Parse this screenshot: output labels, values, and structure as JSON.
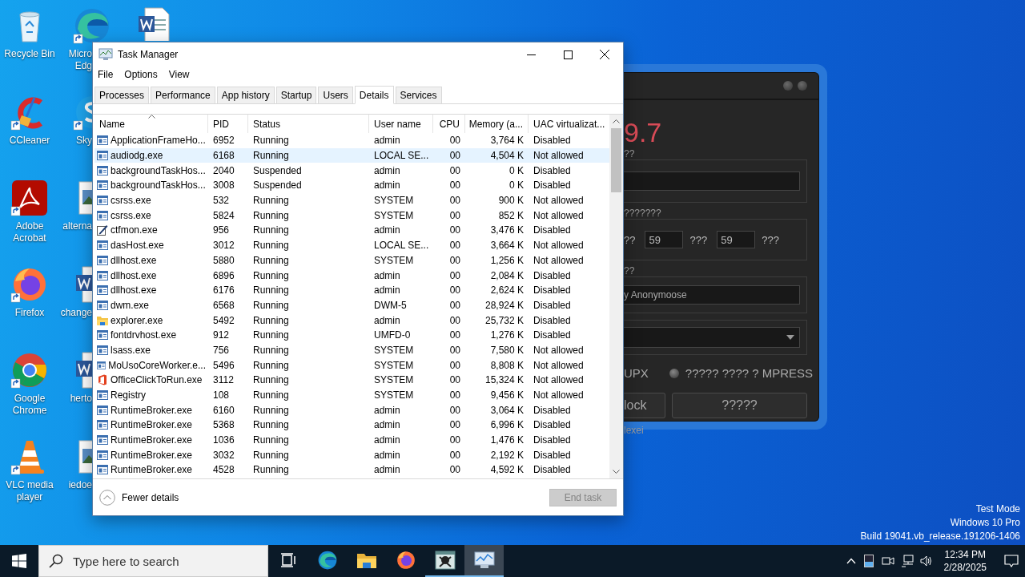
{
  "desktop": {
    "icons": [
      {
        "kind": "recycle",
        "shortcut": false,
        "lines": [
          "Recycle Bin"
        ]
      },
      {
        "kind": "ccleaner",
        "shortcut": true,
        "lines": [
          "CCleaner"
        ]
      },
      {
        "kind": "acrobat",
        "shortcut": true,
        "lines": [
          "Adobe",
          "Acrobat"
        ]
      },
      {
        "kind": "firefox",
        "shortcut": true,
        "lines": [
          "Firefox"
        ]
      },
      {
        "kind": "chrome",
        "shortcut": true,
        "lines": [
          "Google",
          "Chrome"
        ]
      },
      {
        "kind": "vlc",
        "shortcut": true,
        "lines": [
          "VLC media",
          "player"
        ]
      },
      {
        "kind": "edge",
        "shortcut": true,
        "lines": [
          "Micro",
          "Edg"
        ]
      },
      {
        "kind": "skype",
        "shortcut": true,
        "lines": [
          "Sky"
        ]
      },
      {
        "kind": "image",
        "shortcut": false,
        "lines": [
          "alterna"
        ]
      },
      {
        "kind": "word",
        "shortcut": false,
        "lines": [
          "change"
        ]
      },
      {
        "kind": "word",
        "shortcut": false,
        "lines": [
          "herto"
        ]
      },
      {
        "kind": "image",
        "shortcut": false,
        "lines": [
          "iedoe"
        ]
      },
      {
        "kind": "word",
        "shortcut": false
      }
    ],
    "notice": [
      "Test Mode",
      "Windows 10 Pro",
      "Build 19041.vb_release.191206-1406"
    ]
  },
  "background_app": {
    "version": "9.7",
    "name_label": "??",
    "time_label": "???????",
    "time_row": [
      {
        "kind": "label",
        "text": "??"
      },
      {
        "kind": "field",
        "value": "59"
      },
      {
        "kind": "label",
        "text": "???"
      },
      {
        "kind": "field",
        "value": "59"
      },
      {
        "kind": "label",
        "text": "???"
      }
    ],
    "author_label": "??",
    "author_value": "y Anonymoose",
    "upx_label": "UPX",
    "mpress_option": {
      "label": "????? ???? ? MPRESS",
      "selected": false
    },
    "buttons": [
      "lock",
      "?????"
    ],
    "footer": "lexei"
  },
  "task_manager": {
    "title": "Task Manager",
    "menu": [
      "File",
      "Options",
      "View"
    ],
    "tabs": [
      {
        "label": "Processes",
        "selected": false
      },
      {
        "label": "Performance",
        "selected": false
      },
      {
        "label": "App history",
        "selected": false
      },
      {
        "label": "Startup",
        "selected": false
      },
      {
        "label": "Users",
        "selected": false
      },
      {
        "label": "Details",
        "selected": true
      },
      {
        "label": "Services",
        "selected": false
      }
    ],
    "columns": [
      {
        "label": "Name",
        "sorted": true
      },
      {
        "label": "PID",
        "sorted": false
      },
      {
        "label": "Status",
        "sorted": false
      },
      {
        "label": "User name",
        "sorted": false
      },
      {
        "label": "CPU",
        "sorted": false
      },
      {
        "label": "Memory (a...",
        "sorted": false
      },
      {
        "label": "UAC virtualizat...",
        "sorted": false
      }
    ],
    "rows": [
      {
        "kind": "app",
        "name": "ApplicationFrameHo...",
        "pid": "6952",
        "status": "Running",
        "user": "admin",
        "cpu": "00",
        "memory": "3,764 K",
        "uac": "Disabled",
        "selected": false
      },
      {
        "kind": "app",
        "name": "audiodg.exe",
        "pid": "6168",
        "status": "Running",
        "user": "LOCAL SE...",
        "cpu": "00",
        "memory": "4,504 K",
        "uac": "Not allowed",
        "selected": true
      },
      {
        "kind": "app",
        "name": "backgroundTaskHos...",
        "pid": "2040",
        "status": "Suspended",
        "user": "admin",
        "cpu": "00",
        "memory": "0 K",
        "uac": "Disabled",
        "selected": false
      },
      {
        "kind": "app",
        "name": "backgroundTaskHos...",
        "pid": "3008",
        "status": "Suspended",
        "user": "admin",
        "cpu": "00",
        "memory": "0 K",
        "uac": "Disabled",
        "selected": false
      },
      {
        "kind": "app",
        "name": "csrss.exe",
        "pid": "532",
        "status": "Running",
        "user": "SYSTEM",
        "cpu": "00",
        "memory": "900 K",
        "uac": "Not allowed",
        "selected": false
      },
      {
        "kind": "app",
        "name": "csrss.exe",
        "pid": "5824",
        "status": "Running",
        "user": "SYSTEM",
        "cpu": "00",
        "memory": "852 K",
        "uac": "Not allowed",
        "selected": false
      },
      {
        "kind": "pen",
        "name": "ctfmon.exe",
        "pid": "956",
        "status": "Running",
        "user": "admin",
        "cpu": "00",
        "memory": "3,476 K",
        "uac": "Disabled",
        "selected": false
      },
      {
        "kind": "app",
        "name": "dasHost.exe",
        "pid": "3012",
        "status": "Running",
        "user": "LOCAL SE...",
        "cpu": "00",
        "memory": "3,664 K",
        "uac": "Not allowed",
        "selected": false
      },
      {
        "kind": "app",
        "name": "dllhost.exe",
        "pid": "5880",
        "status": "Running",
        "user": "SYSTEM",
        "cpu": "00",
        "memory": "1,256 K",
        "uac": "Not allowed",
        "selected": false
      },
      {
        "kind": "app",
        "name": "dllhost.exe",
        "pid": "6896",
        "status": "Running",
        "user": "admin",
        "cpu": "00",
        "memory": "2,084 K",
        "uac": "Disabled",
        "selected": false
      },
      {
        "kind": "app",
        "name": "dllhost.exe",
        "pid": "6176",
        "status": "Running",
        "user": "admin",
        "cpu": "00",
        "memory": "2,624 K",
        "uac": "Disabled",
        "selected": false
      },
      {
        "kind": "app",
        "name": "dwm.exe",
        "pid": "6568",
        "status": "Running",
        "user": "DWM-5",
        "cpu": "00",
        "memory": "28,924 K",
        "uac": "Disabled",
        "selected": false
      },
      {
        "kind": "folder",
        "name": "explorer.exe",
        "pid": "5492",
        "status": "Running",
        "user": "admin",
        "cpu": "00",
        "memory": "25,732 K",
        "uac": "Disabled",
        "selected": false
      },
      {
        "kind": "app",
        "name": "fontdrvhost.exe",
        "pid": "912",
        "status": "Running",
        "user": "UMFD-0",
        "cpu": "00",
        "memory": "1,276 K",
        "uac": "Disabled",
        "selected": false
      },
      {
        "kind": "app",
        "name": "lsass.exe",
        "pid": "756",
        "status": "Running",
        "user": "SYSTEM",
        "cpu": "00",
        "memory": "7,580 K",
        "uac": "Not allowed",
        "selected": false
      },
      {
        "kind": "app",
        "name": "MoUsoCoreWorker.e...",
        "pid": "5496",
        "status": "Running",
        "user": "SYSTEM",
        "cpu": "00",
        "memory": "8,808 K",
        "uac": "Not allowed",
        "selected": false
      },
      {
        "kind": "office",
        "name": "OfficeClickToRun.exe",
        "pid": "3112",
        "status": "Running",
        "user": "SYSTEM",
        "cpu": "00",
        "memory": "15,324 K",
        "uac": "Not allowed",
        "selected": false
      },
      {
        "kind": "app",
        "name": "Registry",
        "pid": "108",
        "status": "Running",
        "user": "SYSTEM",
        "cpu": "00",
        "memory": "9,456 K",
        "uac": "Not allowed",
        "selected": false
      },
      {
        "kind": "app",
        "name": "RuntimeBroker.exe",
        "pid": "6160",
        "status": "Running",
        "user": "admin",
        "cpu": "00",
        "memory": "3,064 K",
        "uac": "Disabled",
        "selected": false
      },
      {
        "kind": "app",
        "name": "RuntimeBroker.exe",
        "pid": "5368",
        "status": "Running",
        "user": "admin",
        "cpu": "00",
        "memory": "6,996 K",
        "uac": "Disabled",
        "selected": false
      },
      {
        "kind": "app",
        "name": "RuntimeBroker.exe",
        "pid": "1036",
        "status": "Running",
        "user": "admin",
        "cpu": "00",
        "memory": "1,476 K",
        "uac": "Disabled",
        "selected": false
      },
      {
        "kind": "app",
        "name": "RuntimeBroker.exe",
        "pid": "3032",
        "status": "Running",
        "user": "admin",
        "cpu": "00",
        "memory": "2,192 K",
        "uac": "Disabled",
        "selected": false
      },
      {
        "kind": "app",
        "name": "RuntimeBroker.exe",
        "pid": "4528",
        "status": "Running",
        "user": "admin",
        "cpu": "00",
        "memory": "4,592 K",
        "uac": "Disabled",
        "selected": false
      }
    ],
    "fewer_details": "Fewer details",
    "end_task": {
      "label": "End task",
      "disabled": true
    }
  },
  "taskbar": {
    "search": {
      "placeholder": "Type here to search"
    },
    "apps": [
      {
        "kind": "taskview",
        "running": false,
        "active": false
      },
      {
        "kind": "edge",
        "running": false,
        "active": false
      },
      {
        "kind": "folder",
        "running": false,
        "active": false
      },
      {
        "kind": "firefox",
        "running": false,
        "active": false
      },
      {
        "kind": "skull",
        "running": true,
        "active": false
      },
      {
        "kind": "taskmgr",
        "running": true,
        "active": true
      }
    ],
    "time": "12:34 PM",
    "date": "2/28/2025"
  }
}
